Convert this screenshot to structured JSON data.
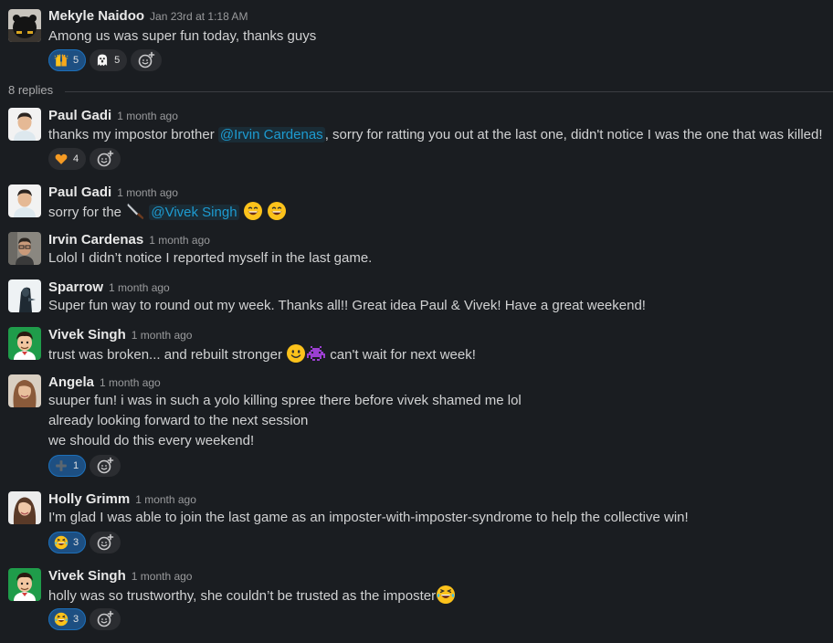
{
  "parent": {
    "name": "Mekyle Naidoo",
    "time": "Jan 23rd at 1:18 AM",
    "text": "Among us was super fun today, thanks guys",
    "reactions": [
      {
        "emoji": "raised-hands",
        "count": "5"
      },
      {
        "emoji": "ghost",
        "count": "5"
      }
    ]
  },
  "replies_label": "8 replies",
  "replies": [
    {
      "name": "Paul Gadi",
      "time": "1 month ago",
      "text_before": "thanks my impostor brother ",
      "mention": "@Irvin Cardenas",
      "text_after": ", sorry for ratting you out at the last one, didn't notice I was the one that was killed!",
      "reactions": [
        {
          "emoji": "orange-heart",
          "count": "4"
        }
      ]
    },
    {
      "name": "Paul Gadi",
      "time": "1 month ago",
      "text_before": "sorry for the ",
      "mention": "@Vivek Singh"
    },
    {
      "name": "Irvin Cardenas",
      "time": "1 month ago",
      "text": "Lolol I didn’t notice I reported myself in the last game."
    },
    {
      "name": "Sparrow",
      "time": "1 month ago",
      "text": "Super fun way to round out my week.  Thanks all!!  Great idea Paul & Vivek!  Have a great weekend!"
    },
    {
      "name": "Vivek Singh",
      "time": "1 month ago",
      "text_before": "trust was broken... and rebuilt stronger ",
      "text_after": " can't wait for next week!"
    },
    {
      "name": "Angela",
      "time": "1 month ago",
      "lines": [
        "suuper fun! i was in such a yolo killing spree there before vivek shamed me lol",
        "already looking forward to the next session",
        "we should do this every weekend!"
      ],
      "reactions": [
        {
          "emoji": "heavy-plus-sign",
          "count": "1"
        }
      ]
    },
    {
      "name": "Holly Grimm",
      "time": "1 month ago",
      "text": "I'm glad I was able to join the last game as an imposter-with-imposter-syndrome to help the collective win!",
      "reactions": [
        {
          "emoji": "joy",
          "count": "3"
        }
      ]
    },
    {
      "name": "Vivek Singh",
      "time": "1 month ago",
      "text": "holly was so trustworthy, she couldn’t be trusted as the imposter",
      "reactions": [
        {
          "emoji": "joy",
          "count": "3"
        }
      ]
    }
  ],
  "colors": {
    "background": "#1a1d21",
    "mention": "#1d9bd1",
    "own_reaction": "#1d4f82"
  }
}
